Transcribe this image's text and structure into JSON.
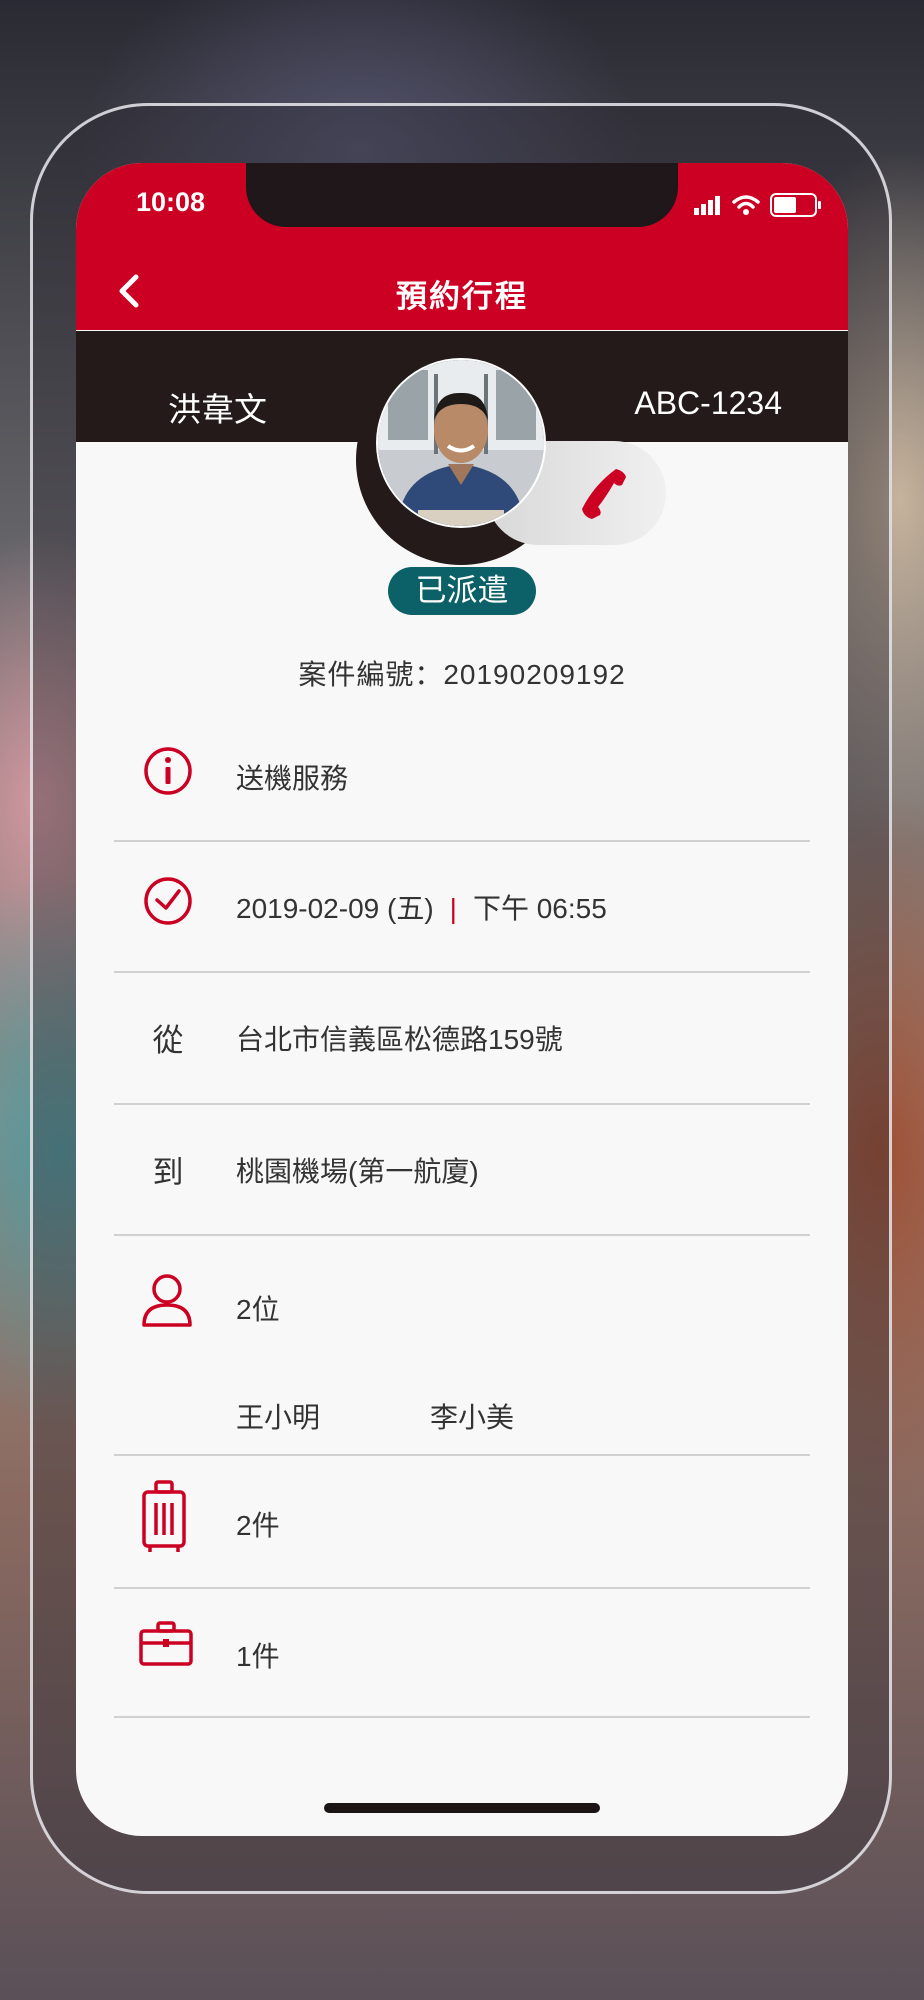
{
  "status_bar": {
    "time": "10:08"
  },
  "header": {
    "title": "預約行程"
  },
  "driver": {
    "name": "洪韋文",
    "plate": "ABC-1234"
  },
  "booking": {
    "status": "已派遣",
    "case_label": "案件編號：20190209192",
    "service": "送機服務",
    "date": "2019-02-09 (五)",
    "time": "下午 06:55",
    "from_label": "從",
    "from": "台北市信義區松德路159號",
    "to_label": "到",
    "to": "桃園機場(第一航廈)",
    "passenger_count": "2位",
    "passengers": [
      "王小明",
      "李小美"
    ],
    "luggage_count": "2件",
    "briefcase_count": "1件"
  },
  "colors": {
    "brand_red": "#cc0022",
    "dark_bar": "#231a19",
    "badge_teal": "#0c6067"
  }
}
